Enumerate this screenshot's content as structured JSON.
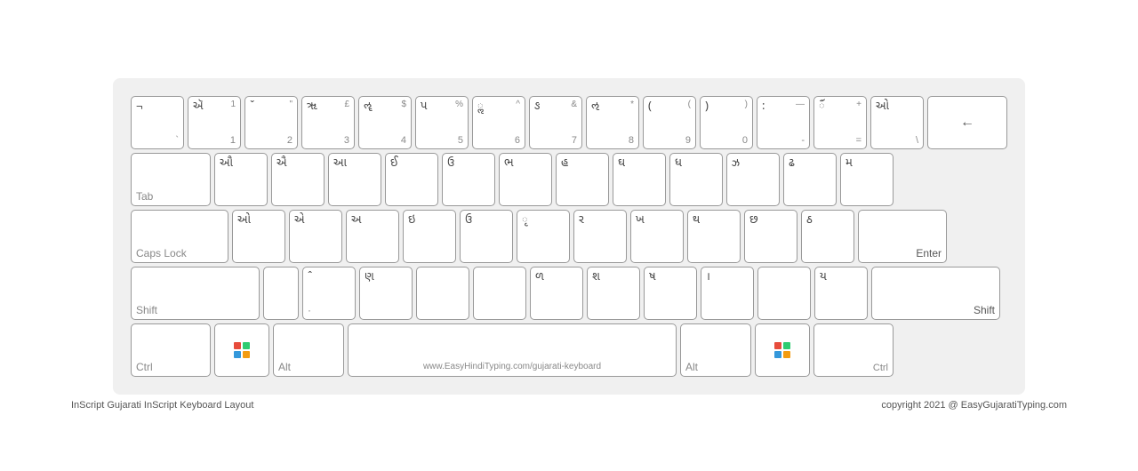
{
  "keyboard": {
    "title": "InScript Gujarati InScript Keyboard Layout",
    "copyright": "copyright 2021 @ EasyGujaratiTyping.com",
    "rows": [
      {
        "id": "row1",
        "keys": [
          {
            "id": "tilde",
            "tl": "¬",
            "br": "`",
            "tr": "",
            "bl": ""
          },
          {
            "id": "1",
            "tl": "ઍ",
            "tr": "1",
            "bl": "",
            "br": "1"
          },
          {
            "id": "2",
            "tl": "ˇ",
            "tr": "\"",
            "bl": "",
            "br": "2"
          },
          {
            "id": "3",
            "tl": "ૠ",
            "tr": "£",
            "bl": "",
            "br": "3"
          },
          {
            "id": "4",
            "tl": "ૡ",
            "tr": "$",
            "bl": "",
            "br": "4"
          },
          {
            "id": "5",
            "tl": "પ",
            "tr": "%",
            "bl": "",
            "br": "5"
          },
          {
            "id": "6",
            "tl": "ૢ",
            "tr": "^",
            "bl": "",
            "br": "6"
          },
          {
            "id": "7",
            "tl": "ઙ",
            "tr": "&",
            "bl": "",
            "br": "7"
          },
          {
            "id": "8",
            "tl": "ઌ",
            "tr": "*",
            "bl": "",
            "br": "8"
          },
          {
            "id": "9",
            "tl": "(",
            "tr": "(",
            "bl": "",
            "br": "9"
          },
          {
            "id": "0",
            "tl": ")",
            "tr": ")",
            "bl": "",
            "br": "0"
          },
          {
            "id": "minus",
            "tl": ":",
            "tr": "—",
            "bl": "",
            "br": "-"
          },
          {
            "id": "equals",
            "tl": "ૼ",
            "tr": "+",
            "bl": "",
            "br": "="
          },
          {
            "id": "backslash",
            "tl": "ઓ",
            "tr": "",
            "bl": "",
            "br": "\\"
          },
          {
            "id": "backspace",
            "tl": "",
            "tr": "",
            "bl": "",
            "br": "←",
            "wide": "back"
          }
        ]
      },
      {
        "id": "row2",
        "keys": [
          {
            "id": "tab",
            "tl": "",
            "tr": "",
            "bl": "Tab",
            "br": "",
            "wide": "tab"
          },
          {
            "id": "q",
            "tl": "ઔ",
            "tr": "",
            "bl": "",
            "br": ""
          },
          {
            "id": "w",
            "tl": "ઐ",
            "tr": "",
            "bl": "",
            "br": ""
          },
          {
            "id": "e",
            "tl": "આ",
            "tr": "",
            "bl": "",
            "br": ""
          },
          {
            "id": "r",
            "tl": "ઈ",
            "tr": "",
            "bl": "",
            "br": ""
          },
          {
            "id": "t",
            "tl": "ઉ",
            "tr": "",
            "bl": "",
            "br": ""
          },
          {
            "id": "y",
            "tl": "ભ",
            "tr": "",
            "bl": "",
            "br": ""
          },
          {
            "id": "u",
            "tl": "હ",
            "tr": "",
            "bl": "",
            "br": ""
          },
          {
            "id": "i",
            "tl": "ઘ",
            "tr": "",
            "bl": "",
            "br": ""
          },
          {
            "id": "o",
            "tl": "ધ",
            "tr": "",
            "bl": "",
            "br": ""
          },
          {
            "id": "p",
            "tl": "ઝ",
            "tr": "",
            "bl": "",
            "br": ""
          },
          {
            "id": "lbracket",
            "tl": "ઢ",
            "tr": "",
            "bl": "",
            "br": ""
          },
          {
            "id": "rbracket",
            "tl": "મ",
            "tr": "",
            "bl": "",
            "br": ""
          },
          {
            "id": "enter_top",
            "tl": "",
            "tr": "",
            "bl": "",
            "br": "",
            "wide": "enter_stub"
          }
        ]
      },
      {
        "id": "row3",
        "keys": [
          {
            "id": "capslock",
            "tl": "",
            "tr": "",
            "bl": "Caps Lock",
            "br": "",
            "wide": "caps"
          },
          {
            "id": "a",
            "tl": "ઓ",
            "tr": "",
            "bl": "",
            "br": ""
          },
          {
            "id": "s",
            "tl": "એ",
            "tr": "",
            "bl": "",
            "br": ""
          },
          {
            "id": "d",
            "tl": "અ",
            "tr": "",
            "bl": "",
            "br": ""
          },
          {
            "id": "f",
            "tl": "ઇ",
            "tr": "",
            "bl": "",
            "br": ""
          },
          {
            "id": "g",
            "tl": "ઉ",
            "tr": "",
            "bl": "",
            "br": ""
          },
          {
            "id": "h",
            "tl": "ૃ",
            "tr": "",
            "bl": "",
            "br": ""
          },
          {
            "id": "j",
            "tl": "ર",
            "tr": "",
            "bl": "",
            "br": ""
          },
          {
            "id": "k",
            "tl": "ખ",
            "tr": "",
            "bl": "",
            "br": ""
          },
          {
            "id": "l",
            "tl": "થ",
            "tr": "",
            "bl": "",
            "br": ""
          },
          {
            "id": "semi",
            "tl": "છ",
            "tr": "",
            "bl": "",
            "br": ""
          },
          {
            "id": "quote",
            "tl": "ઠ",
            "tr": "",
            "bl": "",
            "br": ""
          },
          {
            "id": "enter",
            "tl": "",
            "tr": "",
            "bl": "",
            "br": "Enter",
            "wide": "enter"
          }
        ]
      },
      {
        "id": "row4",
        "keys": [
          {
            "id": "shift_l",
            "tl": "",
            "tr": "",
            "bl": "Shift",
            "br": "",
            "wide": "shift_l"
          },
          {
            "id": "z_blank",
            "tl": "",
            "tr": "",
            "bl": "",
            "br": "",
            "wide": "half"
          },
          {
            "id": "z",
            "tl": "ˆ",
            "tr": "",
            "bl": "·",
            "br": ""
          },
          {
            "id": "x",
            "tl": "ણ",
            "tr": "",
            "bl": "",
            "br": ""
          },
          {
            "id": "c",
            "tl": "",
            "tr": "",
            "bl": "",
            "br": ""
          },
          {
            "id": "v",
            "tl": "",
            "tr": "",
            "bl": "",
            "br": ""
          },
          {
            "id": "b",
            "tl": "ળ",
            "tr": "",
            "bl": "",
            "br": ""
          },
          {
            "id": "n",
            "tl": "શ",
            "tr": "",
            "bl": "",
            "br": ""
          },
          {
            "id": "m",
            "tl": "ષ",
            "tr": "",
            "bl": "",
            "br": ""
          },
          {
            "id": "comma",
            "tl": "।",
            "tr": "",
            "bl": "",
            "br": ""
          },
          {
            "id": "period",
            "tl": "",
            "tr": "",
            "bl": "",
            "br": ""
          },
          {
            "id": "slash",
            "tl": "ય",
            "tr": "",
            "bl": "",
            "br": ""
          },
          {
            "id": "shift_r",
            "tl": "",
            "tr": "",
            "bl": "",
            "br": "Shift",
            "wide": "shift_r"
          }
        ]
      },
      {
        "id": "row5",
        "keys": [
          {
            "id": "ctrl_l",
            "tl": "",
            "tr": "",
            "bl": "Ctrl",
            "br": "",
            "wide": "ctrl"
          },
          {
            "id": "win_l",
            "tl": "",
            "tr": "",
            "bl": "",
            "br": "",
            "wide": "win",
            "iswin": true
          },
          {
            "id": "alt_l",
            "tl": "",
            "tr": "",
            "bl": "Alt",
            "br": "",
            "wide": "alt"
          },
          {
            "id": "space",
            "tl": "",
            "tr": "",
            "bl": "",
            "br": "www.EasyHindiTyping.com/gujarati-keyboard",
            "wide": "space"
          },
          {
            "id": "alt_r",
            "tl": "",
            "tr": "",
            "bl": "Alt",
            "br": "",
            "wide": "alt"
          },
          {
            "id": "win_r",
            "tl": "",
            "tr": "",
            "bl": "",
            "br": "",
            "wide": "win",
            "iswin": true
          },
          {
            "id": "ctrl_r",
            "tl": "",
            "tr": "",
            "bl": "",
            "br": "Ctrl",
            "wide": "ctrl"
          }
        ]
      }
    ]
  }
}
